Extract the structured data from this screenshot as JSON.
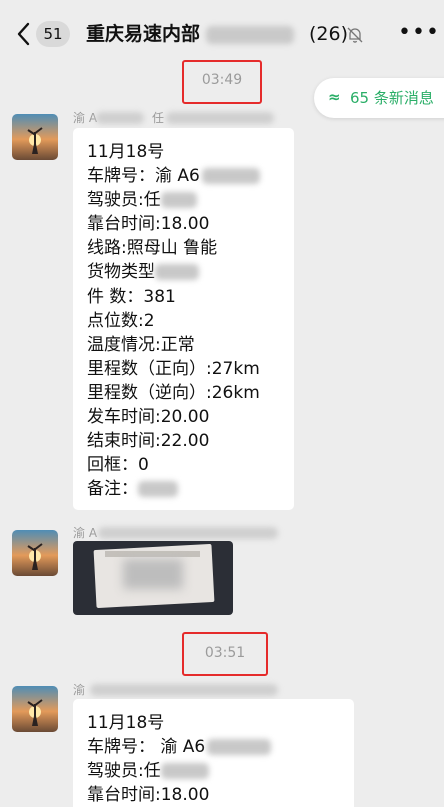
{
  "header": {
    "unread_count": "51",
    "title": "重庆易速内部",
    "member_count": "(26)"
  },
  "new_messages": {
    "label": "65 条新消息",
    "icon": "double-chevron-up"
  },
  "times": [
    "03:49",
    "03:51"
  ],
  "messages": [
    {
      "sender": "渝 A",
      "sender_tail": "任",
      "lines": {
        "date": "11月18号",
        "plate": "车牌号：渝 A6",
        "driver": "驾驶员:任",
        "dock_time": "靠台时间:18.00",
        "route": "线路:照母山 鲁能",
        "goods": "货物类型",
        "pieces": "件  数：381",
        "points": "点位数:2",
        "temperature": "温度情况:正常",
        "mileage_forward": "里程数（正向）:27km",
        "mileage_reverse": "里程数（逆向）:26km",
        "depart_time": "发车时间:20.00",
        "end_time": "结束时间:22.00",
        "return_frame": "回框：0",
        "remark": "备注："
      }
    },
    {
      "sender": "渝 A"
    },
    {
      "sender": "渝",
      "lines": {
        "date": "11月18号",
        "plate": "车牌号：  渝 A6",
        "driver": "驾驶员:任",
        "dock_time": "靠台时间:18.00"
      }
    }
  ],
  "colors": {
    "accent_green": "#2aae67",
    "highlight_red": "#e52b2b",
    "background": "#ededed"
  }
}
